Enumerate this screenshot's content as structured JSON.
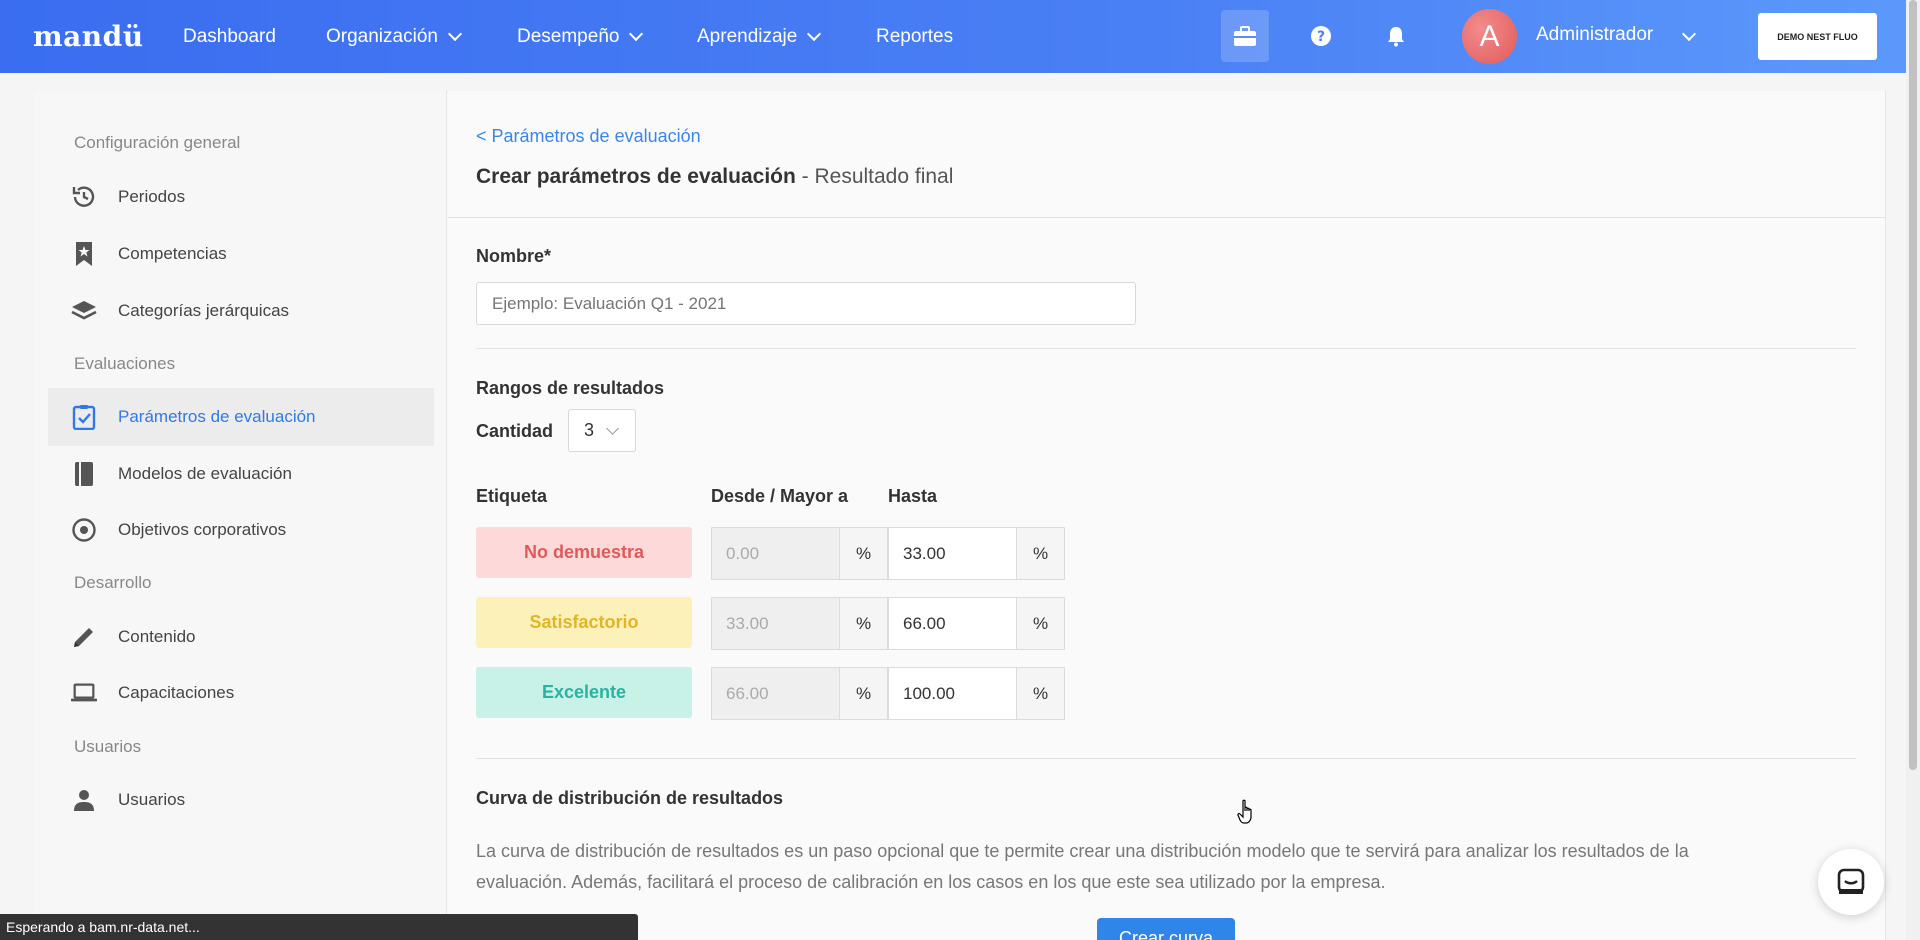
{
  "topbar": {
    "logo": "mandü",
    "nav": [
      {
        "label": "Dashboard"
      },
      {
        "label": "Organización"
      },
      {
        "label": "Desempeño"
      },
      {
        "label": "Aprendizaje"
      },
      {
        "label": "Reportes"
      }
    ],
    "avatar_letter": "A",
    "user_name": "Administrador",
    "demo_button": "DEMO NEST FLUO",
    "accent_color": "#3a6df0"
  },
  "sidebar": {
    "sections": {
      "general": "Configuración general",
      "evaluaciones": "Evaluaciones",
      "desarrollo": "Desarrollo",
      "usuarios": "Usuarios"
    },
    "items": {
      "periodos": "Periodos",
      "competencias": "Competencias",
      "categorias": "Categorías jerárquicas",
      "parametros": "Parámetros de evaluación",
      "modelos": "Modelos de evaluación",
      "objetivos": "Objetivos corporativos",
      "contenido": "Contenido",
      "capacitaciones": "Capacitaciones",
      "usuarios": "Usuarios"
    }
  },
  "main": {
    "breadcrumb": "< Parámetros de evaluación",
    "title": "Crear parámetros de evaluación",
    "subtitle": " - Resultado final",
    "name_label": "Nombre*",
    "name_placeholder": "Ejemplo: Evaluación Q1 - 2021",
    "ranges_label": "Rangos de resultados",
    "quantity_label": "Cantidad",
    "quantity_value": "3",
    "col_label": "Etiqueta",
    "col_from": "Desde / Mayor a",
    "col_to": "Hasta",
    "percent_symbol": "%",
    "ranges": [
      {
        "label": "No demuestra",
        "from": "0.00",
        "to": "33.00",
        "bg": "#fdd9d9",
        "fg": "#e05a5a"
      },
      {
        "label": "Satisfactorio",
        "from": "33.00",
        "to": "66.00",
        "bg": "#fcf1b8",
        "fg": "#e0b52a"
      },
      {
        "label": "Excelente",
        "from": "66.00",
        "to": "100.00",
        "bg": "#c8f1e8",
        "fg": "#2ab3a1"
      }
    ],
    "curve_title": "Curva de distribución de resultados",
    "curve_desc": "La curva de distribución de resultados es un paso opcional que te permite crear una distribución modelo que te servirá para analizar los resultados de la evaluación. Además, facilitará el proceso de calibración en los casos en los que este sea utilizado por la empresa.",
    "create_curve_button": "Crear curva"
  },
  "status_bar": "Esperando a bam.nr-data.net..."
}
